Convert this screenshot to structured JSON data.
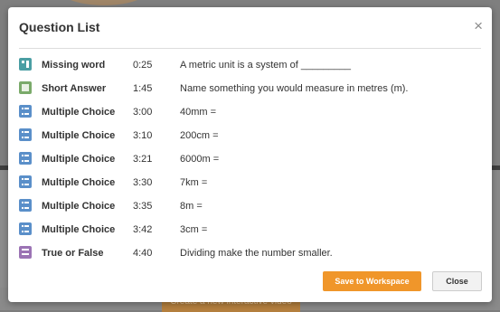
{
  "modal": {
    "title": "Question List",
    "close_icon": "×"
  },
  "questions": [
    {
      "type": "Missing word",
      "time": "0:25",
      "text": "A metric unit is a system of _________",
      "icon": "missing-word-icon"
    },
    {
      "type": "Short Answer",
      "time": "1:45",
      "text": "Name something you would measure in metres (m).",
      "icon": "short-answer-icon"
    },
    {
      "type": "Multiple Choice",
      "time": "3:00",
      "text": "40mm =",
      "icon": "multiple-choice-icon"
    },
    {
      "type": "Multiple Choice",
      "time": "3:10",
      "text": "200cm =",
      "icon": "multiple-choice-icon"
    },
    {
      "type": "Multiple Choice",
      "time": "3:21",
      "text": "6000m =",
      "icon": "multiple-choice-icon"
    },
    {
      "type": "Multiple Choice",
      "time": "3:30",
      "text": "7km =",
      "icon": "multiple-choice-icon"
    },
    {
      "type": "Multiple Choice",
      "time": "3:35",
      "text": "8m =",
      "icon": "multiple-choice-icon"
    },
    {
      "type": "Multiple Choice",
      "time": "3:42",
      "text": "3cm =",
      "icon": "multiple-choice-icon"
    },
    {
      "type": "True or False",
      "time": "4:40",
      "text": "Dividing make the number smaller.",
      "icon": "true-false-icon"
    }
  ],
  "footer": {
    "save_label": "Save to Workspace",
    "close_label": "Close"
  },
  "background": {
    "cta_label": "Create a new interactive video"
  },
  "colors": {
    "accent": "#f0962a",
    "missing_word": "#4a9ea3",
    "short_answer": "#7aaa6a",
    "multiple_choice": "#5a8fc9",
    "true_false": "#9b73b4"
  }
}
